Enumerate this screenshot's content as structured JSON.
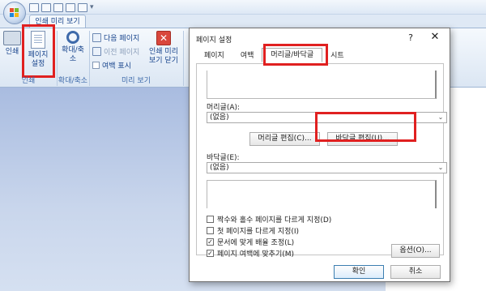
{
  "ribbon": {
    "tab_label": "인쇄 미리 보기",
    "buttons": {
      "print": "인쇄",
      "page_setup_line1": "페이지",
      "page_setup_line2": "설정",
      "zoom": "확대/축소",
      "next_page": "다음 페이지",
      "prev_page": "이전 페이지",
      "show_margins": "여백 표시",
      "close_line1": "인쇄 미리",
      "close_line2": "보기 닫기"
    },
    "groups": {
      "print": "인쇄",
      "zoom": "확대/축소",
      "preview": "미리 보기"
    }
  },
  "dialog": {
    "title": "페이지 설정",
    "help": "?",
    "close": "✕",
    "tabs": [
      "페이지",
      "여백",
      "머리글/바닥글",
      "시트"
    ],
    "active_tab": "머리글/바닥글",
    "header_label": "머리글(A):",
    "header_value": "(없음)",
    "header_edit_btn": "머리글 편집(C)...",
    "footer_edit_btn": "바닥글 편집(U)...",
    "footer_label": "바닥글(E):",
    "footer_value": "(없음)",
    "checkboxes": [
      {
        "label": "짝수와 홀수 페이지를 다르게 지정(D)",
        "checked": false
      },
      {
        "label": "첫 페이지를 다르게 지정(I)",
        "checked": false
      },
      {
        "label": "문서에 맞게 배율 조정(L)",
        "checked": true
      },
      {
        "label": "페이지 여백에 맞추기(M)",
        "checked": true
      }
    ],
    "options_btn": "옵션(O)...",
    "ok_btn": "확인",
    "cancel_btn": "취소"
  },
  "check_mark": "✓",
  "colors": {
    "highlight": "#e02020",
    "ribbon_text": "#15428b"
  }
}
